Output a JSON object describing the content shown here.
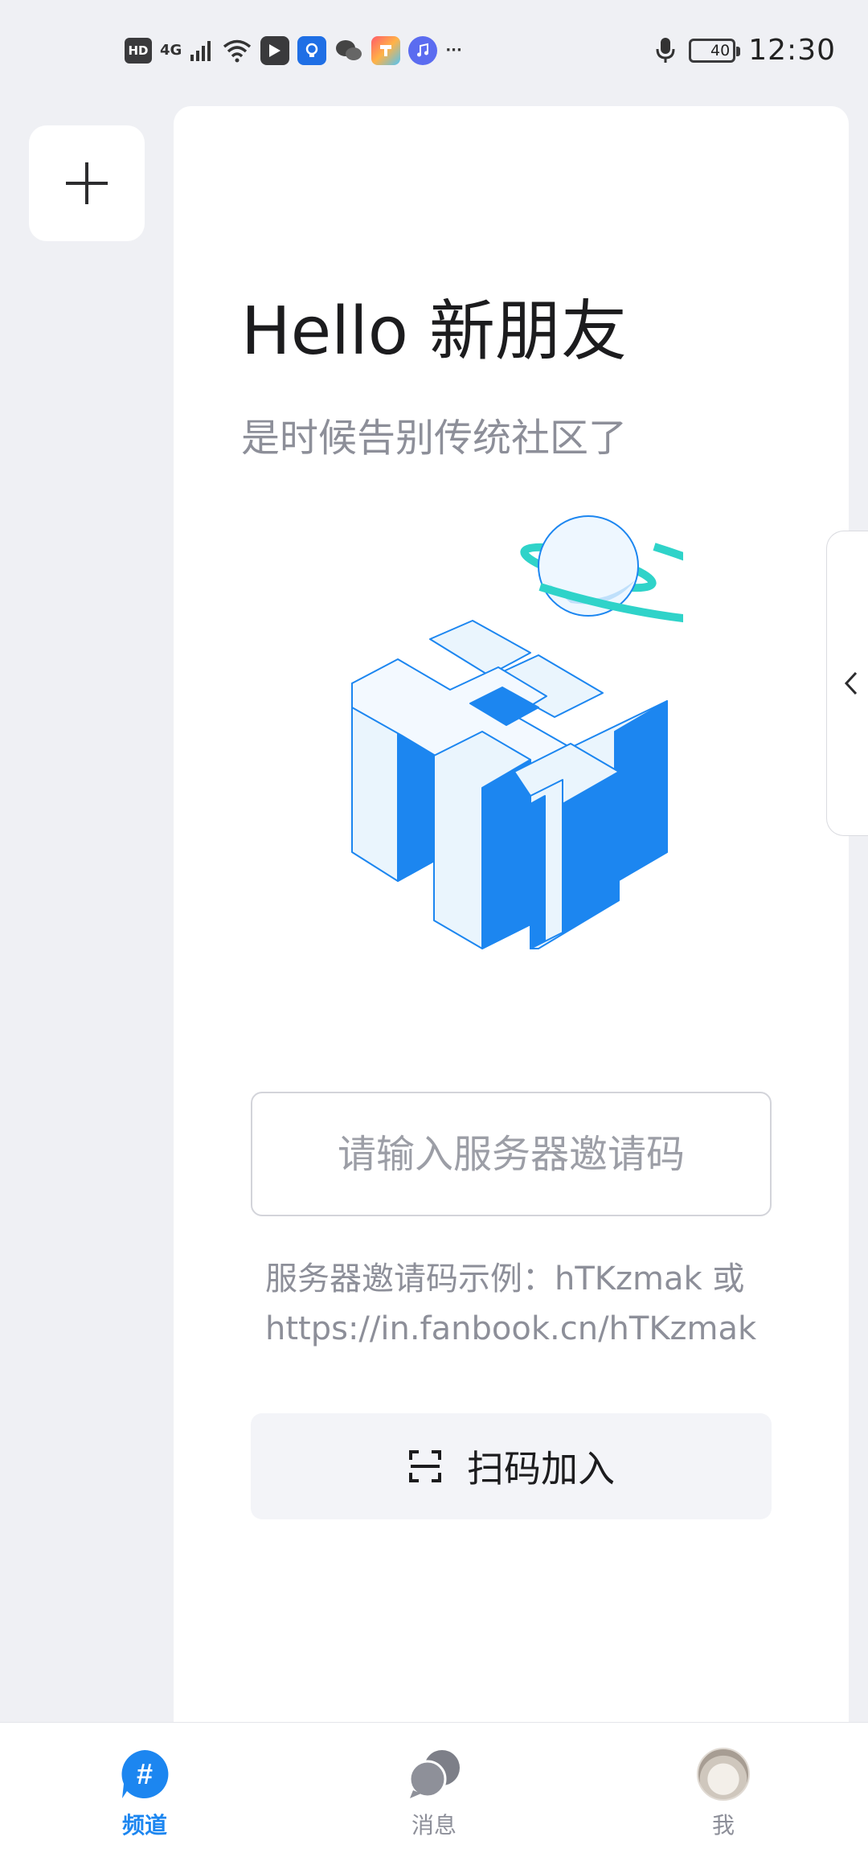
{
  "status_bar": {
    "left_badges": [
      "HD",
      "4G"
    ],
    "more": "···",
    "battery": "40",
    "time": "12:30"
  },
  "colors": {
    "accent": "#1c86f0",
    "background": "#eff0f4",
    "muted_text": "#8d8f99"
  },
  "main": {
    "title": "Hello 新朋友",
    "subtitle": "是时候告别传统社区了",
    "invite_input": {
      "placeholder": "请输入服务器邀请码",
      "value": ""
    },
    "hint_line1": "服务器邀请码示例：hTKzmak 或",
    "hint_line2": "https://in.fanbook.cn/hTKzmak",
    "scan_button_label": "扫码加入"
  },
  "bottom_nav": {
    "items": [
      {
        "label": "频道",
        "icon": "hashtag-icon",
        "active": true
      },
      {
        "label": "消息",
        "icon": "chat-bubbles-icon",
        "active": false
      },
      {
        "label": "我",
        "icon": "avatar",
        "active": false
      }
    ]
  }
}
